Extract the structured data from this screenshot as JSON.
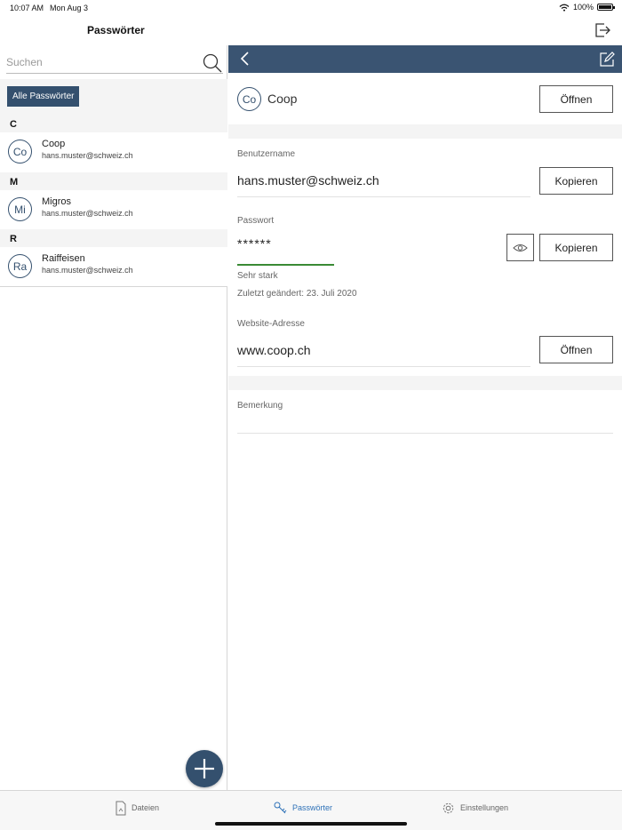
{
  "status_bar": {
    "time": "10:07 AM",
    "date": "Mon Aug 3",
    "battery": "100%"
  },
  "nav": {
    "title": "Passwörter"
  },
  "search": {
    "placeholder": "Suchen"
  },
  "filter": {
    "label": "Alle Passwörter"
  },
  "sections": [
    {
      "letter": "C",
      "items": [
        {
          "initials": "Co",
          "name": "Coop",
          "email": "hans.muster@schweiz.ch"
        }
      ]
    },
    {
      "letter": "M",
      "items": [
        {
          "initials": "Mi",
          "name": "Migros",
          "email": "hans.muster@schweiz.ch"
        }
      ]
    },
    {
      "letter": "R",
      "items": [
        {
          "initials": "Ra",
          "name": "Raiffeisen",
          "email": "hans.muster@schweiz.ch"
        }
      ]
    }
  ],
  "detail": {
    "initials": "Co",
    "name": "Coop",
    "open_label": "Öffnen",
    "username_label": "Benutzername",
    "username": "hans.muster@schweiz.ch",
    "copy_label": "Kopieren",
    "password_label": "Passwort",
    "password_masked": "******",
    "strength": "Sehr stark",
    "last_changed": "Zuletzt geändert: 23. Juli 2020",
    "website_label": "Website-Adresse",
    "website": "www.coop.ch",
    "note_label": "Bemerkung"
  },
  "tabs": [
    {
      "label": "Dateien",
      "icon": "file-icon",
      "active": false
    },
    {
      "label": "Passwörter",
      "icon": "key-icon",
      "active": true
    },
    {
      "label": "Einstellungen",
      "icon": "gear-icon",
      "active": false
    }
  ],
  "colors": {
    "accent": "#34506e",
    "header": "#3a5472",
    "tab_active": "#2f72b8",
    "strength": "#3a8a35"
  }
}
